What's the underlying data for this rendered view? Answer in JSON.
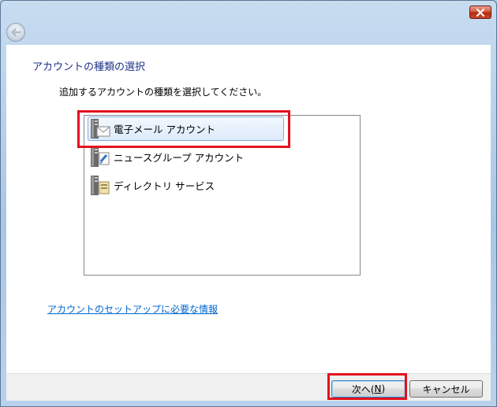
{
  "window": {
    "close_icon": "close-icon",
    "back_icon": "back-arrow-icon",
    "accent_close": "#c7482a"
  },
  "page": {
    "title": "アカウントの種類の選択",
    "instruction": "追加するアカウントの種類を選択してください。",
    "help_link": "アカウントのセットアップに必要な情報"
  },
  "account_types": [
    {
      "label": "電子メール アカウント",
      "icon": "email-account-icon",
      "selected": true
    },
    {
      "label": "ニュースグループ アカウント",
      "icon": "newsgroup-account-icon",
      "selected": false
    },
    {
      "label": "ディレクトリ サービス",
      "icon": "directory-service-icon",
      "selected": false
    }
  ],
  "buttons": {
    "next_prefix": "次へ(",
    "next_mnemonic": "N",
    "next_suffix": ")",
    "cancel": "キャンセル"
  },
  "highlight_color": "#e3101e"
}
